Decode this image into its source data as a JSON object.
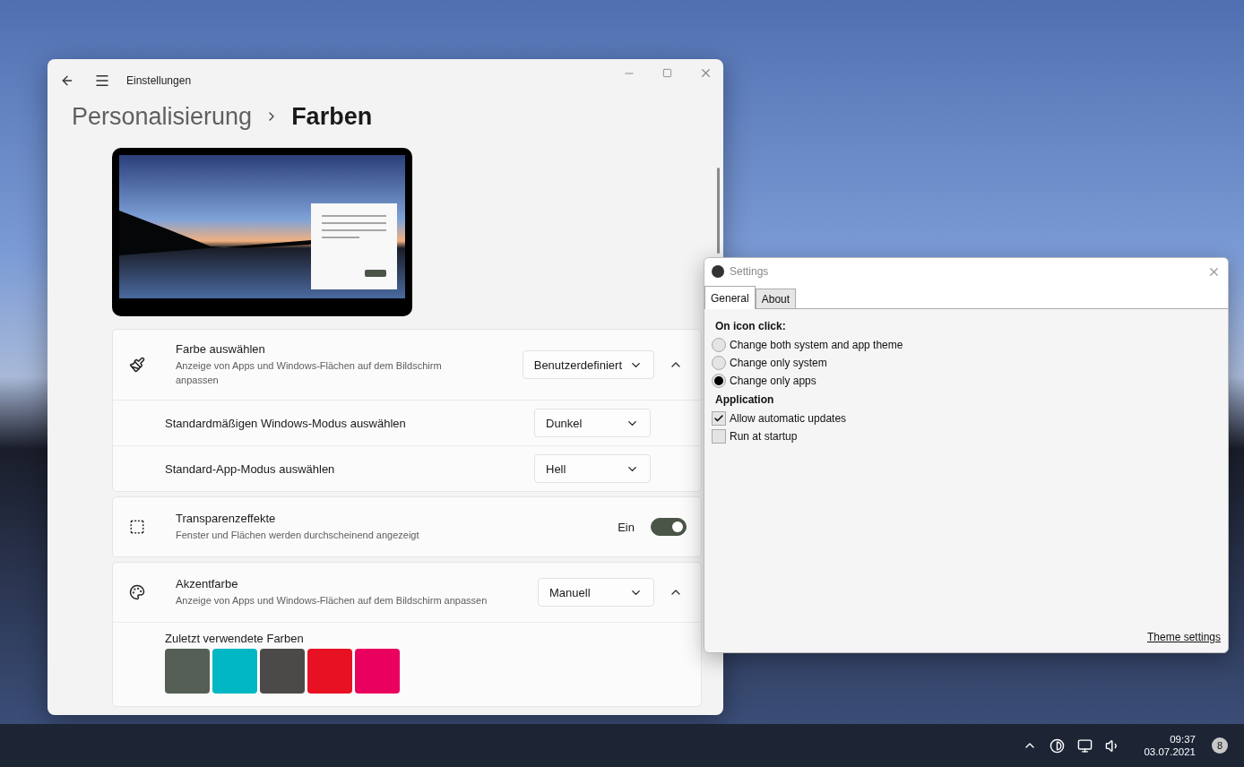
{
  "settings_window": {
    "title": "Einstellungen",
    "breadcrumb": {
      "parent": "Personalisierung",
      "current": "Farben"
    },
    "cards": [
      {
        "kind": "group",
        "expanded": true,
        "title": "Farbe auswählen",
        "description": "Anzeige von Apps und Windows-Flächen auf dem Bildschirm anpassen",
        "dropdown": "Benutzerdefiniert",
        "rows": [
          {
            "label": "Standardmäßigen Windows-Modus auswählen",
            "dropdown": "Dunkel"
          },
          {
            "label": "Standard-App-Modus auswählen",
            "dropdown": "Hell"
          }
        ]
      },
      {
        "kind": "toggle",
        "title": "Transparenzeffekte",
        "description": "Fenster und Flächen werden durchscheinend angezeigt",
        "state_label": "Ein",
        "on": true
      },
      {
        "kind": "accent",
        "expanded": true,
        "title": "Akzentfarbe",
        "description": "Anzeige von Apps und Windows-Flächen auf dem Bildschirm anpassen",
        "dropdown": "Manuell",
        "recent_label": "Zuletzt verwendete Farben",
        "swatches": [
          {
            "color": "#555f55"
          },
          {
            "color": "#00b7c3"
          },
          {
            "color": "#4c4a48"
          },
          {
            "color": "#e81123"
          },
          {
            "color": "#ea005e"
          }
        ]
      }
    ]
  },
  "theme_app": {
    "title": "Settings",
    "tabs": [
      {
        "label": "General",
        "selected": true
      },
      {
        "label": "About",
        "selected": false
      }
    ],
    "sections": [
      {
        "kind": "radio",
        "heading": "On icon click:",
        "options": [
          {
            "label": "Change both system and app theme",
            "selected": false
          },
          {
            "label": "Change only system",
            "selected": false
          },
          {
            "label": "Change only apps",
            "selected": true
          }
        ]
      },
      {
        "kind": "checkbox",
        "heading": "Application",
        "options": [
          {
            "label": "Allow automatic updates",
            "checked": true
          },
          {
            "label": "Run at startup",
            "checked": false
          }
        ]
      }
    ],
    "link": "Theme settings"
  },
  "taskbar": {
    "time": "09:37",
    "date": "03.07.2021",
    "notification_count": "8"
  }
}
